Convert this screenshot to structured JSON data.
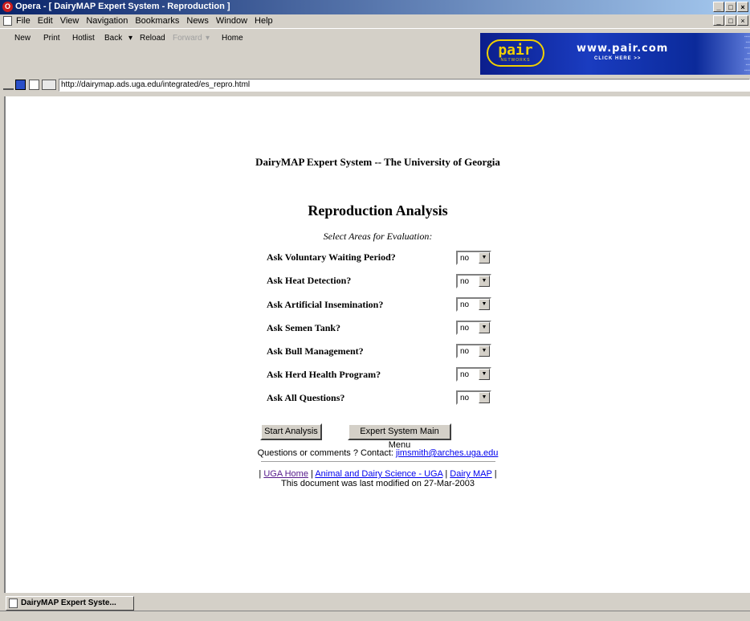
{
  "window": {
    "title": "Opera - [ DairyMAP Expert System - Reproduction ]",
    "controls": [
      "_",
      "□",
      "×"
    ]
  },
  "menu": [
    "File",
    "Edit",
    "View",
    "Navigation",
    "Bookmarks",
    "News",
    "Window",
    "Help"
  ],
  "toolbar": {
    "new": "New",
    "print": "Print",
    "hotlist": "Hotlist",
    "back": "Back",
    "reload": "Reload",
    "forward": "Forward",
    "home": "Home"
  },
  "banner": {
    "logo": "pair",
    "logo_sub": "NETWORKS",
    "url": "www.pair.com",
    "cta": "CLICK HERE >>"
  },
  "address": {
    "url": "http://dairymap.ads.uga.edu/integrated/es_repro.html"
  },
  "page": {
    "site_title": "DairyMAP Expert System -- The University of Georgia",
    "heading": "Reproduction Analysis",
    "subheading": "Select Areas for Evaluation:",
    "questions": [
      {
        "label": "Ask Voluntary Waiting Period?",
        "value": "no"
      },
      {
        "label": "Ask Heat Detection?",
        "value": "no"
      },
      {
        "label": "Ask Artificial Insemination?",
        "value": "no"
      },
      {
        "label": "Ask Semen Tank?",
        "value": "no"
      },
      {
        "label": "Ask Bull Management?",
        "value": "no"
      },
      {
        "label": "Ask Herd Health Program?",
        "value": "no"
      },
      {
        "label": "Ask All Questions?",
        "value": "no"
      }
    ],
    "buttons": {
      "start": "Start Analysis",
      "main_menu": "Expert System Main Menu"
    },
    "contact_text": "Questions or comments ? Contact:",
    "contact_email": "jimsmith@arches.uga.edu",
    "links": {
      "sep": "|",
      "uga_home": "UGA Home",
      "animal_dairy": "Animal and Dairy Science - UGA",
      "dairy_map": "Dairy MAP"
    },
    "modified": "This document was last modified on 27-Mar-2003"
  },
  "taskbar": {
    "tab": "DairyMAP Expert Syste..."
  }
}
